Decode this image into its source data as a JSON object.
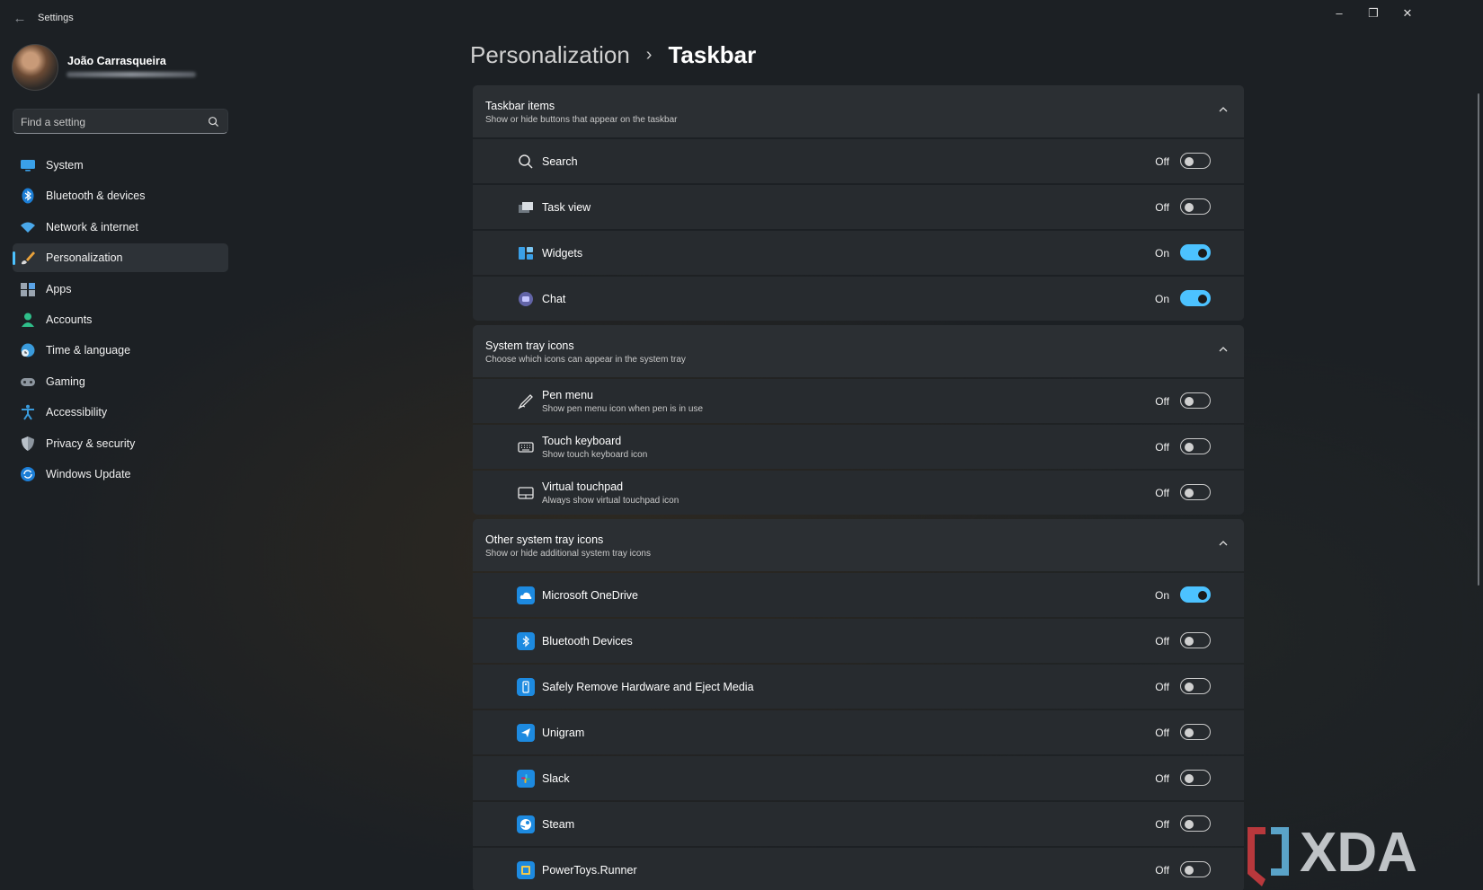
{
  "window": {
    "title": "Settings",
    "controls": {
      "minimize": "–",
      "maximize": "❐",
      "close": "✕"
    }
  },
  "profile": {
    "name": "João Carrasqueira"
  },
  "search": {
    "placeholder": "Find a setting"
  },
  "sidebar": {
    "active": "Personalization",
    "accent_color": "#4cc2ff",
    "items": [
      {
        "label": "System",
        "icon": "system-icon"
      },
      {
        "label": "Bluetooth & devices",
        "icon": "bluetooth-icon"
      },
      {
        "label": "Network & internet",
        "icon": "wifi-icon"
      },
      {
        "label": "Personalization",
        "icon": "brush-icon"
      },
      {
        "label": "Apps",
        "icon": "apps-icon"
      },
      {
        "label": "Accounts",
        "icon": "person-icon"
      },
      {
        "label": "Time & language",
        "icon": "globe-clock-icon"
      },
      {
        "label": "Gaming",
        "icon": "gamepad-icon"
      },
      {
        "label": "Accessibility",
        "icon": "accessibility-icon"
      },
      {
        "label": "Privacy & security",
        "icon": "shield-icon"
      },
      {
        "label": "Windows Update",
        "icon": "update-icon"
      }
    ]
  },
  "breadcrumb": {
    "parent": "Personalization",
    "separator": "›",
    "current": "Taskbar"
  },
  "sections": [
    {
      "title": "Taskbar items",
      "subtitle": "Show or hide buttons that appear on the taskbar",
      "rows": [
        {
          "title": "Search",
          "state": "Off",
          "icon": "search-icon"
        },
        {
          "title": "Task view",
          "state": "Off",
          "icon": "task-view-icon"
        },
        {
          "title": "Widgets",
          "state": "On",
          "icon": "widgets-icon"
        },
        {
          "title": "Chat",
          "state": "On",
          "icon": "chat-icon"
        }
      ]
    },
    {
      "title": "System tray icons",
      "subtitle": "Choose which icons can appear in the system tray",
      "rows": [
        {
          "title": "Pen menu",
          "subtitle": "Show pen menu icon when pen is in use",
          "state": "Off",
          "icon": "pen-icon"
        },
        {
          "title": "Touch keyboard",
          "subtitle": "Show touch keyboard icon",
          "state": "Off",
          "icon": "keyboard-icon"
        },
        {
          "title": "Virtual touchpad",
          "subtitle": "Always show virtual touchpad icon",
          "state": "Off",
          "icon": "touchpad-icon"
        }
      ]
    },
    {
      "title": "Other system tray icons",
      "subtitle": "Show or hide additional system tray icons",
      "rows": [
        {
          "title": "Microsoft OneDrive",
          "state": "On",
          "icon": "onedrive-icon"
        },
        {
          "title": "Bluetooth Devices",
          "state": "Off",
          "icon": "bluetooth-icon"
        },
        {
          "title": "Safely Remove Hardware and Eject Media",
          "state": "Off",
          "icon": "usb-drive-icon"
        },
        {
          "title": "Unigram",
          "state": "Off",
          "icon": "unigram-icon"
        },
        {
          "title": "Slack",
          "state": "Off",
          "icon": "slack-icon"
        },
        {
          "title": "Steam",
          "state": "Off",
          "icon": "steam-icon"
        },
        {
          "title": "PowerToys.Runner",
          "state": "Off",
          "icon": "powertoys-icon"
        }
      ]
    }
  ],
  "watermark": {
    "text": "XDA"
  }
}
